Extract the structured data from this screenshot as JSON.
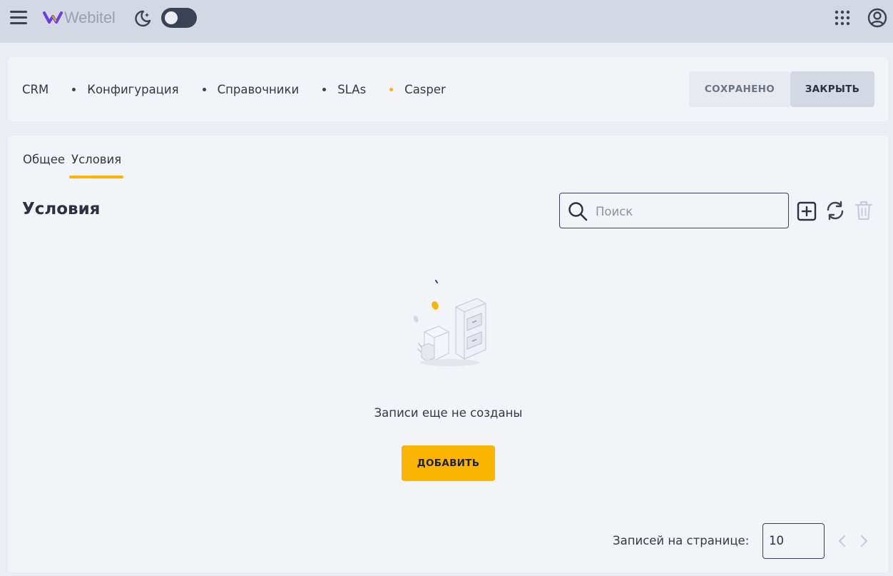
{
  "app": {
    "logo_text": "Webitel"
  },
  "breadcrumbs": [
    "CRM",
    "Конфигурация",
    "Справочники",
    "SLAs",
    "Casper"
  ],
  "header": {
    "saved_label": "СОХРАНЕНО",
    "close_label": "ЗАКРЫТЬ"
  },
  "tabs": [
    {
      "label": "Общее",
      "active": false
    },
    {
      "label": "Условия",
      "active": true
    }
  ],
  "section": {
    "title": "Условия"
  },
  "search": {
    "placeholder": "Поиск",
    "value": ""
  },
  "empty_state": {
    "message": "Записи еще не созданы",
    "add_label": "ДОБАВИТЬ"
  },
  "pagination": {
    "per_page_label": "Записей на странице:",
    "per_page_value": "10"
  },
  "icons": [
    "menu-icon",
    "moon-icon",
    "apps-grid-icon",
    "account-icon",
    "search-icon",
    "add-icon",
    "refresh-icon",
    "trash-icon",
    "chevron-left-icon",
    "chevron-right-icon"
  ],
  "colors": {
    "accent": "#f9b500",
    "topbar": "#d4d8e3",
    "card": "#f3f4f8",
    "text": "#333849",
    "logo_purple": "#6b3ee0"
  }
}
